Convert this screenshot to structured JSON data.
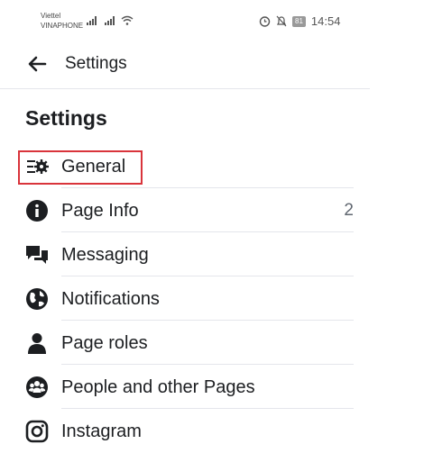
{
  "status_bar": {
    "carrier_1": "Viettel",
    "carrier_2": "VINAPHONE",
    "battery": "81",
    "time": "14:54"
  },
  "topbar": {
    "title": "Settings"
  },
  "page": {
    "title": "Settings"
  },
  "items": [
    {
      "label": "General",
      "icon": "general-settings-icon",
      "count": ""
    },
    {
      "label": "Page Info",
      "icon": "info-icon",
      "count": "2"
    },
    {
      "label": "Messaging",
      "icon": "messaging-icon",
      "count": ""
    },
    {
      "label": "Notifications",
      "icon": "globe-icon",
      "count": ""
    },
    {
      "label": "Page roles",
      "icon": "person-icon",
      "count": ""
    },
    {
      "label": "People and other Pages",
      "icon": "people-icon",
      "count": ""
    },
    {
      "label": "Instagram",
      "icon": "instagram-icon",
      "count": ""
    }
  ],
  "colors": {
    "highlight": "#d9343b",
    "text": "#1c1e21",
    "divider": "#e4e6eb"
  }
}
